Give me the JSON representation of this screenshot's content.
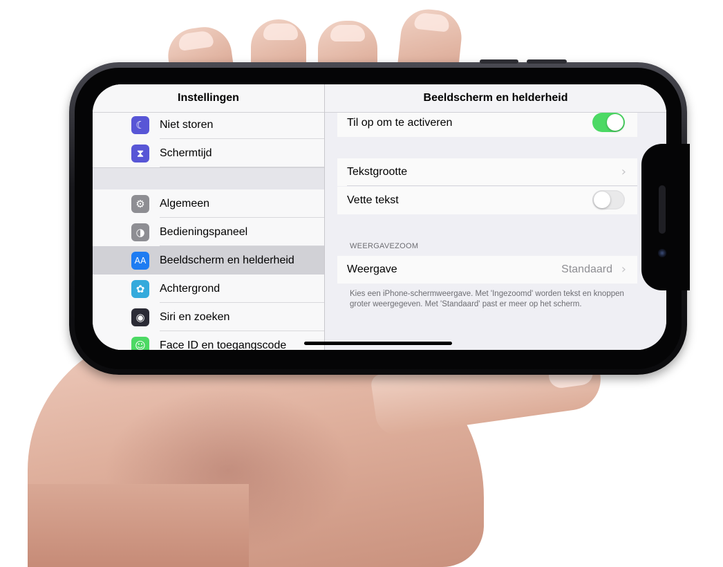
{
  "master": {
    "title": "Instellingen",
    "group1": [
      {
        "label": "Niet storen",
        "icon": "moon-icon",
        "color": "#5856d6",
        "glyph": "☾"
      },
      {
        "label": "Schermtijd",
        "icon": "hourglass-icon",
        "color": "#5856d6",
        "glyph": "⧗"
      }
    ],
    "group2": [
      {
        "label": "Algemeen",
        "icon": "gear-icon",
        "color": "#8e8e93",
        "glyph": "⚙"
      },
      {
        "label": "Bedieningspaneel",
        "icon": "toggles-icon",
        "color": "#8e8e93",
        "glyph": "◑"
      },
      {
        "label": "Beeldscherm en helderheid",
        "icon": "text-size-icon",
        "color": "#1e7cf2",
        "glyph": "AA",
        "selected": true
      },
      {
        "label": "Achtergrond",
        "icon": "flower-icon",
        "color": "#34aadc",
        "glyph": "✿"
      },
      {
        "label": "Siri en zoeken",
        "icon": "siri-icon",
        "color": "#2b2b35",
        "glyph": "◉"
      },
      {
        "label": "Face ID en toegangscode",
        "icon": "face-id-icon",
        "color": "#4cd964",
        "glyph": "☺"
      }
    ]
  },
  "detail": {
    "title": "Beeldscherm en helderheid",
    "raise_to_wake": {
      "label": "Til op om te activeren",
      "on": true
    },
    "text_size": {
      "label": "Tekstgrootte"
    },
    "bold_text": {
      "label": "Vette tekst",
      "on": false
    },
    "zoom_header": "WEERGAVEZOOM",
    "view": {
      "label": "Weergave",
      "value": "Standaard"
    },
    "footer": "Kies een iPhone-schermweergave. Met 'Ingezoomd' worden tekst en knoppen groter weergegeven. Met 'Standaard' past er meer op het scherm."
  },
  "colors": {
    "switch_on": "#4cd964",
    "selection": "#d1d1d6"
  }
}
